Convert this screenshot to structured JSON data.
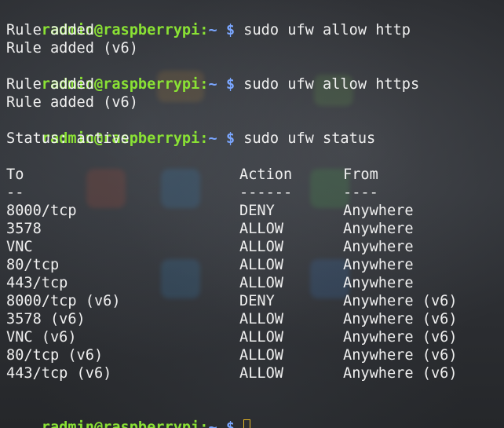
{
  "colors": {
    "prompt_user": "#8ae234",
    "prompt_path": "#7aa6ff",
    "text": "#f0f0f0",
    "cursor": "#e8b824"
  },
  "prompt": {
    "user_host": "radmin@raspberrypi",
    "colon": ":",
    "path": "~",
    "dollar": "$"
  },
  "session": {
    "cmd1": "sudo ufw allow http",
    "out1a": "Rule added",
    "out1b": "Rule added (v6)",
    "cmd2": "sudo ufw allow https",
    "out2a": "Rule added",
    "out2b": "Rule added (v6)",
    "cmd3": "sudo ufw status",
    "status": "Status: active"
  },
  "table": {
    "headers": {
      "to": "To",
      "action": "Action",
      "from": "From"
    },
    "dashes": {
      "to": "--",
      "action": "------",
      "from": "----"
    },
    "rows": [
      {
        "to": "8000/tcp",
        "action": "DENY",
        "from": "Anywhere"
      },
      {
        "to": "3578",
        "action": "ALLOW",
        "from": "Anywhere"
      },
      {
        "to": "VNC",
        "action": "ALLOW",
        "from": "Anywhere"
      },
      {
        "to": "80/tcp",
        "action": "ALLOW",
        "from": "Anywhere"
      },
      {
        "to": "443/tcp",
        "action": "ALLOW",
        "from": "Anywhere"
      },
      {
        "to": "8000/tcp (v6)",
        "action": "DENY",
        "from": "Anywhere (v6)"
      },
      {
        "to": "3578 (v6)",
        "action": "ALLOW",
        "from": "Anywhere (v6)"
      },
      {
        "to": "VNC (v6)",
        "action": "ALLOW",
        "from": "Anywhere (v6)"
      },
      {
        "to": "80/tcp (v6)",
        "action": "ALLOW",
        "from": "Anywhere (v6)"
      },
      {
        "to": "443/tcp (v6)",
        "action": "ALLOW",
        "from": "Anywhere (v6)"
      }
    ]
  }
}
